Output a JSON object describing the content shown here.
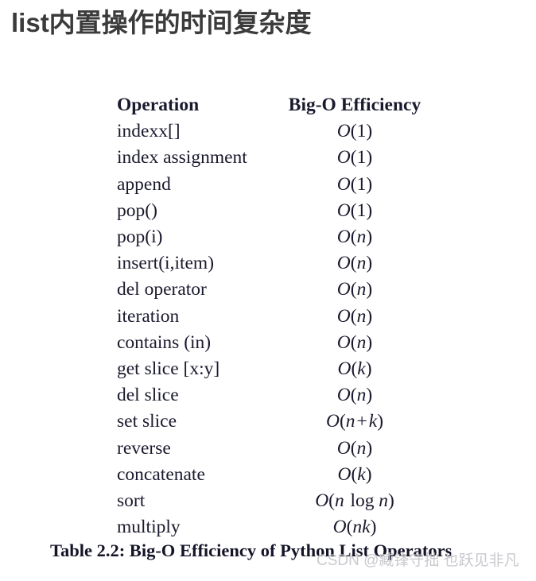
{
  "page": {
    "title": "list内置操作的时间复杂度",
    "background_color": "#ffffff",
    "title_color": "#3b3b3b",
    "text_color": "#1a1a2e"
  },
  "table": {
    "caption": "Table 2.2: Big-O Efficiency of Python List Operators",
    "headers": {
      "operation": "Operation",
      "efficiency": "Big-O Efficiency"
    },
    "rows": [
      {
        "operation": "indexx[]",
        "efficiency": "O(1)"
      },
      {
        "operation": "index assignment",
        "efficiency": "O(1)"
      },
      {
        "operation": "append",
        "efficiency": "O(1)"
      },
      {
        "operation": "pop()",
        "efficiency": "O(1)"
      },
      {
        "operation": "pop(i)",
        "efficiency": "O(n)"
      },
      {
        "operation": "insert(i,item)",
        "efficiency": "O(n)"
      },
      {
        "operation": "del operator",
        "efficiency": "O(n)"
      },
      {
        "operation": "iteration",
        "efficiency": "O(n)"
      },
      {
        "operation": "contains (in)",
        "efficiency": "O(n)"
      },
      {
        "operation": "get slice [x:y]",
        "efficiency": "O(k)"
      },
      {
        "operation": "del slice",
        "efficiency": "O(n)"
      },
      {
        "operation": "set slice",
        "efficiency": "O(n + k)"
      },
      {
        "operation": "reverse",
        "efficiency": "O(n)"
      },
      {
        "operation": "concatenate",
        "efficiency": "O(k)"
      },
      {
        "operation": "sort",
        "efficiency": "O(n log n)"
      },
      {
        "operation": "multiply",
        "efficiency": "O(nk)"
      }
    ]
  },
  "watermark": {
    "text": "CSDN @臧锋守拙 也跃见非凡",
    "color": "#c9c9cf"
  }
}
